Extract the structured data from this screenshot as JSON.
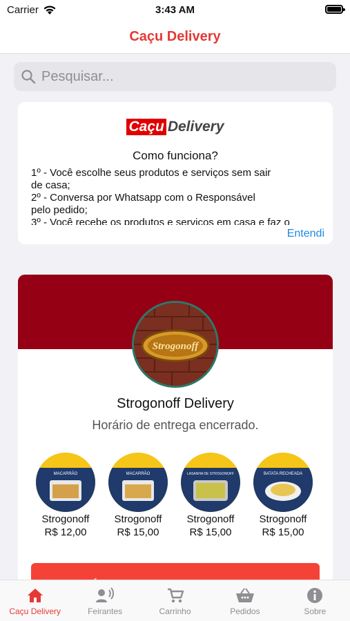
{
  "status_bar": {
    "carrier": "Carrier",
    "time": "3:43 AM"
  },
  "nav": {
    "title": "Caçu Delivery"
  },
  "search": {
    "placeholder": "Pesquisar..."
  },
  "info_card": {
    "logo_part1": "Caçu",
    "logo_part2": "Delivery",
    "heading": "Como funciona?",
    "steps": "1º - Você escolhe seus produtos e serviços sem sair\nde casa;\n2º - Conversa por Whatsapp com o Responsável\npelo pedido;\n3º - Você recebe os produtos e serviços em casa e faz o",
    "dismiss_label": "Entendi"
  },
  "store": {
    "avatar_text": "Strogonoff",
    "name": "Strogonoff Delivery",
    "hours_status": "Horário de entrega encerrado.",
    "products": [
      {
        "name": "Strogonoff",
        "price": "R$ 12,00",
        "label": "MACARRÃO"
      },
      {
        "name": "Strogonoff",
        "price": "R$ 15,00",
        "label": "MACARRÃO"
      },
      {
        "name": "Strogonoff",
        "price": "R$ 15,00",
        "label": "LASANHA DE STROGONOFF"
      },
      {
        "name": "Strogonoff",
        "price": "R$ 15,00",
        "label": "BATATA RECHEADA"
      }
    ],
    "closed_button": "HORÁRIO DE ENTREGA ENCERRADO"
  },
  "tabs": [
    {
      "label": "Caçu Delivery",
      "icon": "home-icon",
      "active": true
    },
    {
      "label": "Feirantes",
      "icon": "megaphone-icon",
      "active": false
    },
    {
      "label": "Carrinho",
      "icon": "cart-icon",
      "active": false
    },
    {
      "label": "Pedidos",
      "icon": "basket-icon",
      "active": false
    },
    {
      "label": "Sobre",
      "icon": "info-icon",
      "active": false
    }
  ],
  "colors": {
    "accent": "#e53935",
    "banner": "#950015",
    "link": "#1e88e5"
  }
}
